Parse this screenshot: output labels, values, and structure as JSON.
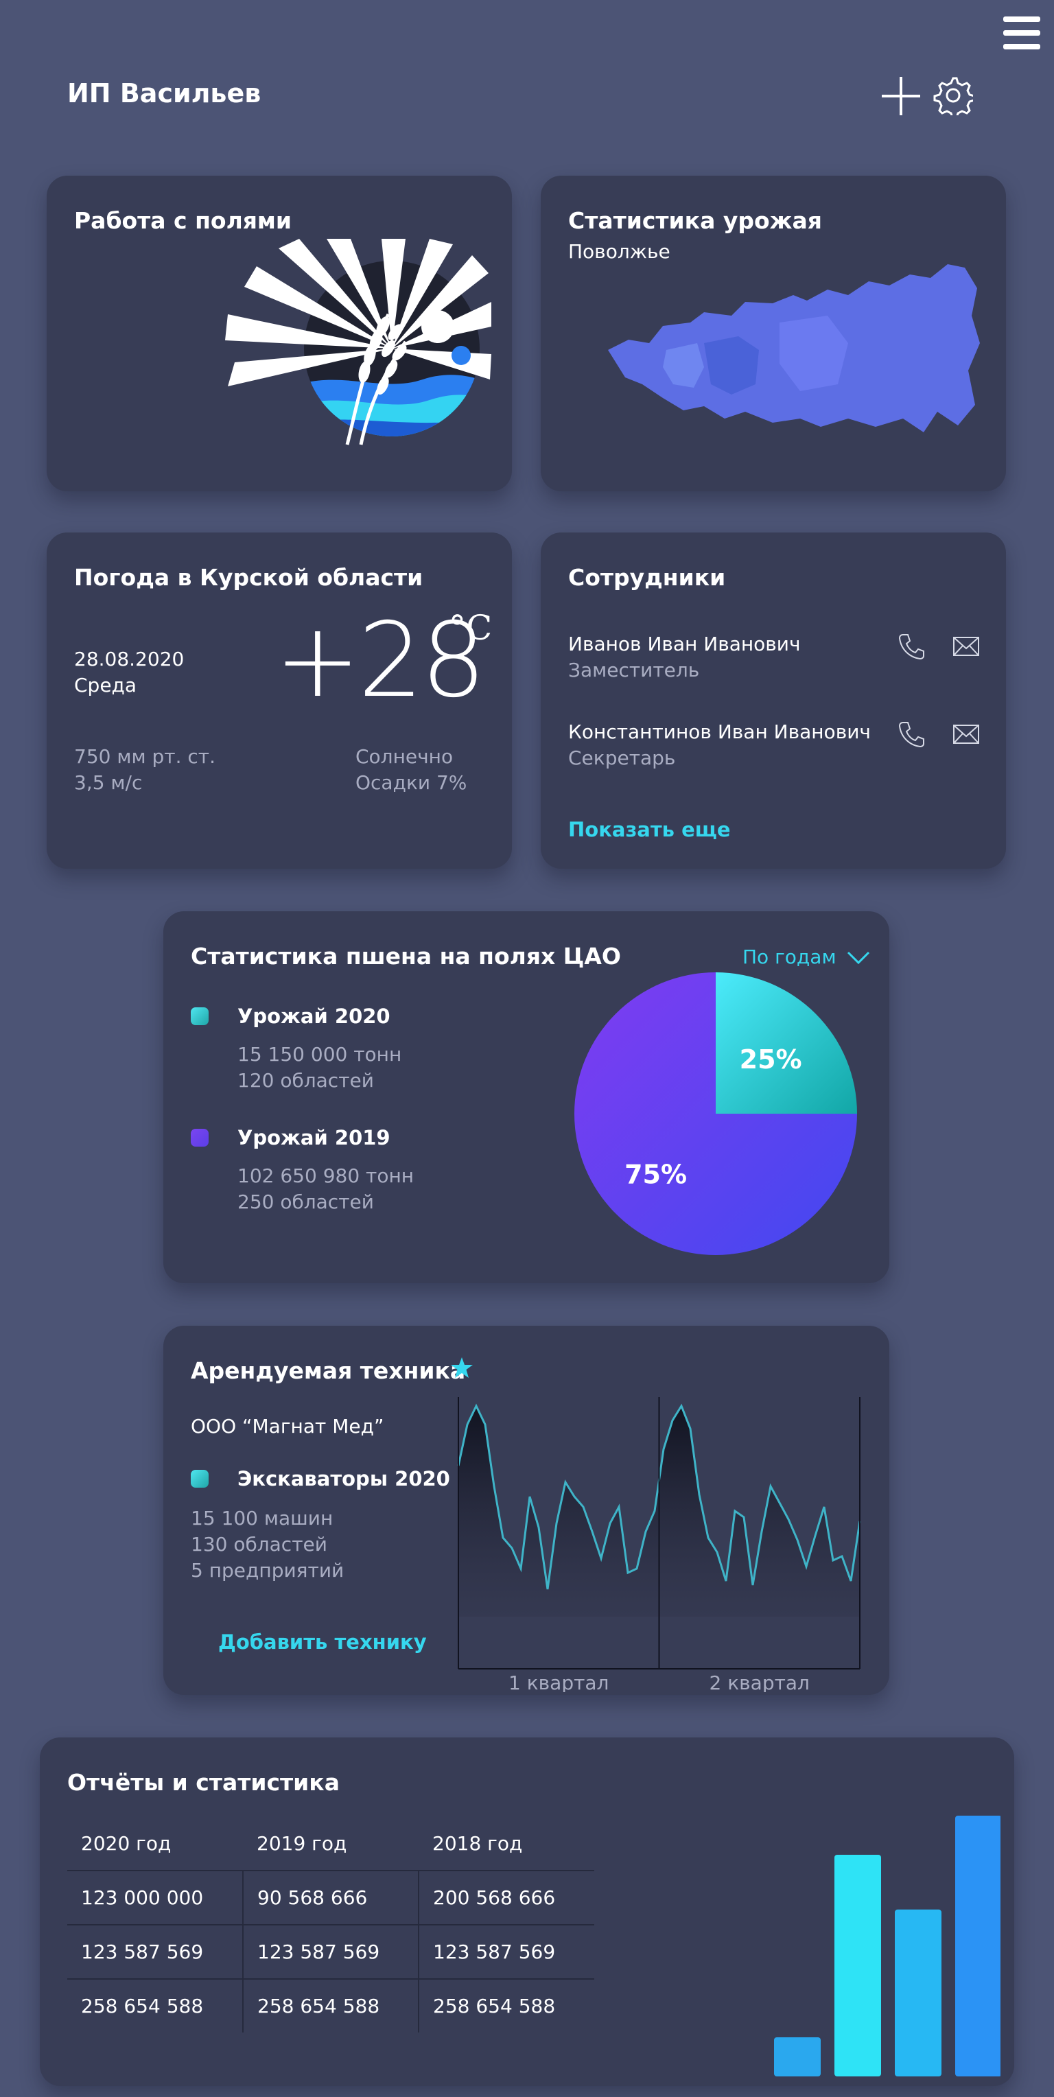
{
  "header": {
    "title": "ИП Васильев",
    "menu_icon": "hamburger-icon",
    "add_icon": "plus-icon",
    "settings_icon": "gear-icon"
  },
  "fields_card": {
    "title": "Работа с полями",
    "icon": "wheat-sun-logo"
  },
  "harvest_card": {
    "title": "Статистика урожая",
    "region": "Поволжье",
    "icon": "russia-map"
  },
  "weather": {
    "title": "Погода в Курской области",
    "date": "28.08.2020",
    "weekday": "Среда",
    "temp": "+28",
    "unit": "°C",
    "pressure": "750 мм рт. ст.",
    "wind": "3,5 м/с",
    "condition": "Солнечно",
    "precip": "Осадки 7%"
  },
  "staff": {
    "title": "Сотрудники",
    "items": [
      {
        "name": "Иванов Иван Иванович",
        "role": "Заместитель"
      },
      {
        "name": "Константинов Иван Иванович",
        "role": "Секретарь"
      }
    ],
    "show_more": "Показать еще"
  },
  "wheat": {
    "title": "Статистика пшена на полях ЦАО",
    "filter": "По годам",
    "legend": [
      {
        "name": "Урожай 2020",
        "tons": "15 150 000 тонн",
        "regions": "120 областей",
        "color": "#2cc6cc"
      },
      {
        "name": "Урожай 2019",
        "tons": "102 650 980 тонн",
        "regions": "250 областей",
        "color": "#6a44ee"
      }
    ]
  },
  "rental": {
    "title": "Арендуемая техника",
    "company": "ООО “Магнат Мед”",
    "item": "Экскаваторы 2020",
    "machines": "15 100 машин",
    "regions": "130 областей",
    "companies": "5 предприятий",
    "add_label": "Добавить технику",
    "accent_color": "#36d7ee"
  },
  "reports": {
    "title": "Отчёты и статистика",
    "columns": [
      "2020 год",
      "2019 год",
      "2018 год"
    ],
    "rows": [
      [
        "123 000 000",
        "90 568 666",
        "200 568 666"
      ],
      [
        "123 587 569",
        "123 587 569",
        "123 587 569"
      ],
      [
        "258 654 588",
        "258 654 588",
        "258 654 588"
      ]
    ]
  },
  "chart_data": [
    {
      "type": "pie",
      "title": "",
      "slices": [
        {
          "label": "25%",
          "value": 25,
          "color": "#2fd6ea"
        },
        {
          "label": "75%",
          "value": 75,
          "color": "#6048f0"
        }
      ]
    },
    {
      "type": "line",
      "title": "",
      "categories": [
        "1 квартал",
        "2 квартал"
      ],
      "series": [
        {
          "values": [
            0.7,
            0.9,
            0.99,
            0.9,
            0.6,
            0.35,
            0.3,
            0.2,
            0.55,
            0.4,
            0.1,
            0.42,
            0.62,
            0.55,
            0.5,
            0.38,
            0.25,
            0.42,
            0.5,
            0.18,
            0.2,
            0.38,
            0.48,
            0.78,
            0.92,
            0.99,
            0.88,
            0.56,
            0.35,
            0.28,
            0.14,
            0.48,
            0.45,
            0.12,
            0.38,
            0.6,
            0.52,
            0.44,
            0.34,
            0.21,
            0.36,
            0.5,
            0.24,
            0.26,
            0.14,
            0.43
          ]
        }
      ]
    },
    {
      "type": "bar",
      "title": "",
      "categories": [
        "",
        "",
        "",
        ""
      ],
      "values": [
        15,
        85,
        64,
        100
      ],
      "colors": [
        "#2aa8ee",
        "#2ee3f6",
        "#27b8f3",
        "#2b93f5"
      ]
    }
  ]
}
